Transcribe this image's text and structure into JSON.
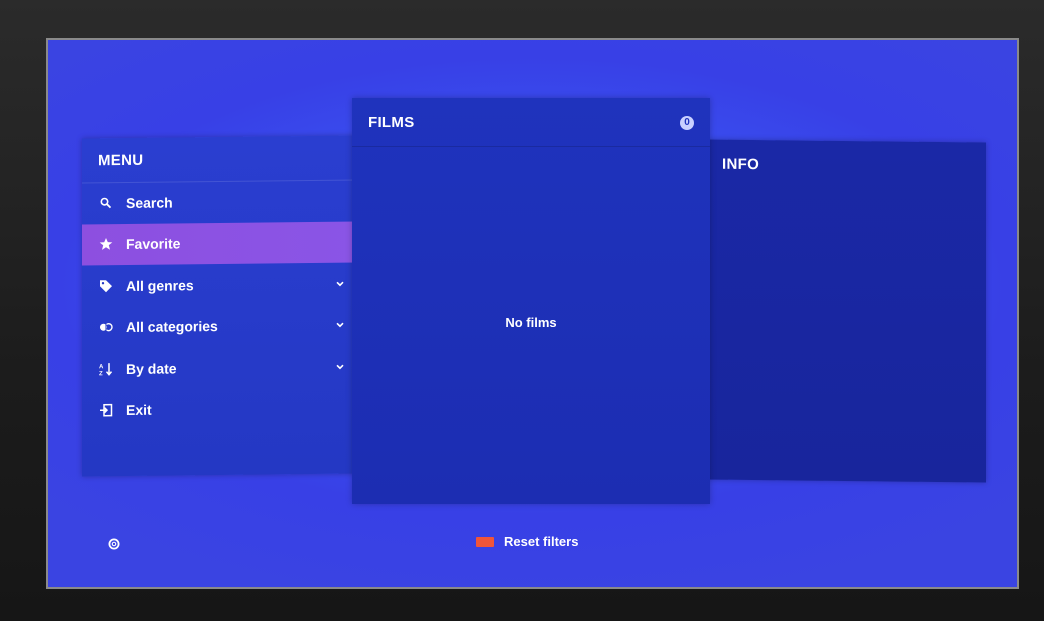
{
  "menu": {
    "title": "MENU",
    "items": [
      {
        "label": "Search",
        "icon": "search-icon",
        "has_dropdown": false,
        "selected": false
      },
      {
        "label": "Favorite",
        "icon": "star-icon",
        "has_dropdown": false,
        "selected": true
      },
      {
        "label": "All genres",
        "icon": "tag-icon",
        "has_dropdown": true,
        "selected": false
      },
      {
        "label": "All categories",
        "icon": "categories-icon",
        "has_dropdown": true,
        "selected": false
      },
      {
        "label": "By date",
        "icon": "sort-icon",
        "has_dropdown": true,
        "selected": false
      },
      {
        "label": "Exit",
        "icon": "exit-icon",
        "has_dropdown": false,
        "selected": false
      }
    ],
    "selected_color": "#8d4fe0"
  },
  "films": {
    "title": "FILMS",
    "count": "0",
    "empty_message": "No films"
  },
  "info": {
    "title": "INFO"
  },
  "footer": {
    "back_icon": "back-circle-icon",
    "reset_label": "Reset filters",
    "reset_key_color": "#f0553a"
  }
}
